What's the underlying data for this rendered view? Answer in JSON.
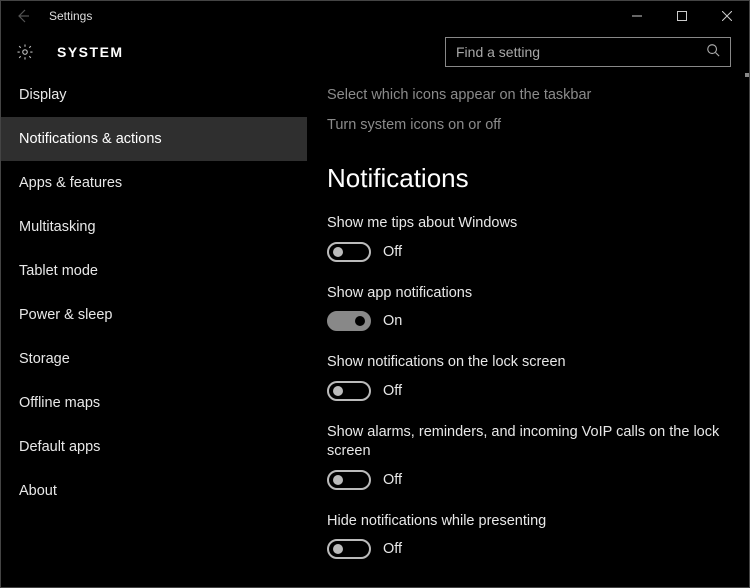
{
  "title": "Settings",
  "section": "SYSTEM",
  "search": {
    "placeholder": "Find a setting"
  },
  "sidebar": {
    "items": [
      {
        "label": "Display"
      },
      {
        "label": "Notifications & actions"
      },
      {
        "label": "Apps & features"
      },
      {
        "label": "Multitasking"
      },
      {
        "label": "Tablet mode"
      },
      {
        "label": "Power & sleep"
      },
      {
        "label": "Storage"
      },
      {
        "label": "Offline maps"
      },
      {
        "label": "Default apps"
      },
      {
        "label": "About"
      }
    ],
    "selected_index": 1
  },
  "main": {
    "links": [
      "Select which icons appear on the taskbar",
      "Turn system icons on or off"
    ],
    "heading": "Notifications",
    "toggles": [
      {
        "label": "Show me tips about Windows",
        "on": false,
        "state": "Off"
      },
      {
        "label": "Show app notifications",
        "on": true,
        "state": "On"
      },
      {
        "label": "Show notifications on the lock screen",
        "on": false,
        "state": "Off"
      },
      {
        "label": "Show alarms, reminders, and incoming VoIP calls on the lock screen",
        "on": false,
        "state": "Off"
      },
      {
        "label": "Hide notifications while presenting",
        "on": false,
        "state": "Off"
      }
    ]
  }
}
